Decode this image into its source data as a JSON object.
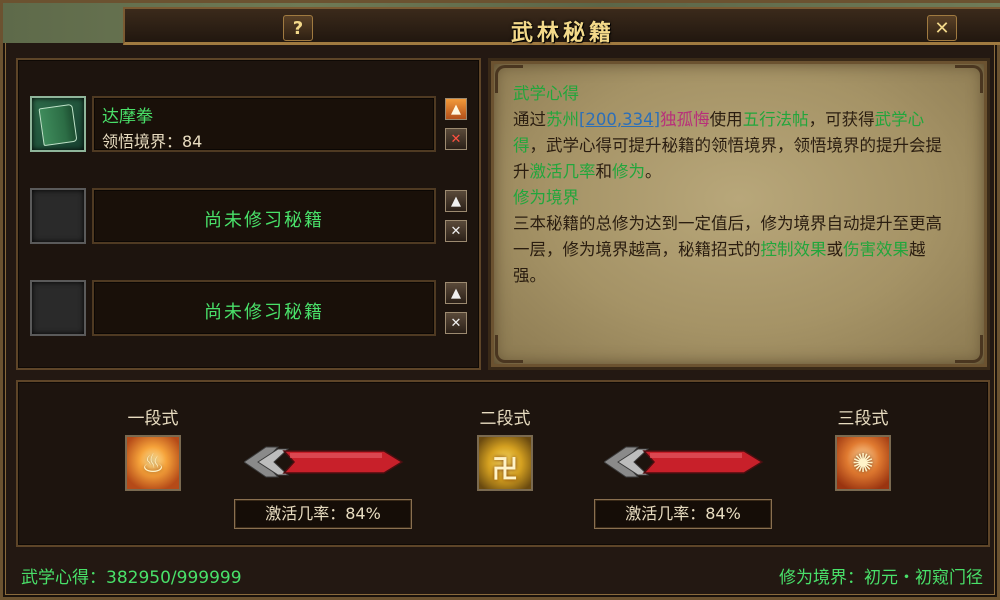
{
  "window": {
    "title": "武林秘籍",
    "help_label": "?",
    "close_label": "✕"
  },
  "slots": [
    {
      "name": "达摩拳",
      "level_text": "领悟境界：84",
      "filled": true,
      "icon": "green-book-icon"
    },
    {
      "empty_text": "尚未修习秘籍",
      "filled": false
    },
    {
      "empty_text": "尚未修习秘籍",
      "filled": false
    }
  ],
  "slot_buttons": {
    "up_glyph": "▲",
    "remove_glyph": "✕"
  },
  "info": {
    "heading1": "武学心得",
    "p1_a": "通过",
    "p1_place": "苏州",
    "p1_coord": "[200,334]",
    "p1_npc": "独孤悔",
    "p1_b": "使用",
    "p1_item": "五行法帖",
    "p1_c": "，可获得",
    "p1_term": "武学心得",
    "p1_d": "，武学心得可提升秘籍的领悟境界，领悟境界的提升会提升",
    "p1_term2": "激活几率",
    "p1_e": "和",
    "p1_term3": "修为",
    "p1_f": "。",
    "heading2": "修为境界",
    "p2_a": "三本秘籍的总修为达到一定值后，修为境界自动提升至更高一层，修为境界越高，秘籍招式的",
    "p2_term1": "控制效果",
    "p2_b": "或",
    "p2_term2": "伤害效果",
    "p2_c": "越强。"
  },
  "stages": [
    {
      "label": "一段式",
      "icon": "flame-figure-icon",
      "glyph": "♨"
    },
    {
      "label": "二段式",
      "icon": "golden-seal-icon",
      "glyph": "卍"
    },
    {
      "label": "三段式",
      "icon": "fire-spirit-icon",
      "glyph": "✺"
    }
  ],
  "rates": [
    {
      "text": "激活几率：84%"
    },
    {
      "text": "激活几率：84%"
    }
  ],
  "footer": {
    "left": "武学心得：382950/999999",
    "right": "修为境界：初元・初窥门径"
  },
  "colors": {
    "accent_green": "#49e069",
    "title_gold": "#f3d98a",
    "bar_red": "#c8202a"
  }
}
